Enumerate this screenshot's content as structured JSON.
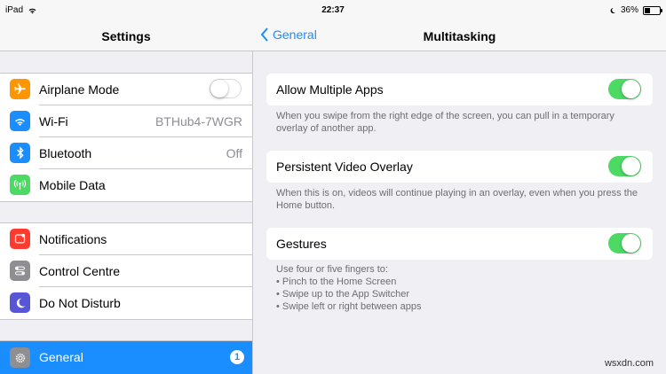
{
  "status": {
    "device": "iPad",
    "time": "22:37",
    "battery": "36%",
    "battery_level": 0.36
  },
  "sidebar": {
    "title": "Settings",
    "group1": [
      {
        "label": "Airplane Mode",
        "icon": "airplane-icon",
        "color": "#ff9500",
        "value": ""
      },
      {
        "label": "Wi-Fi",
        "icon": "wifi-icon",
        "color": "#1a8dff",
        "value": "BTHub4-7WGR"
      },
      {
        "label": "Bluetooth",
        "icon": "bluetooth-icon",
        "color": "#1a8dff",
        "value": "Off"
      },
      {
        "label": "Mobile Data",
        "icon": "antenna-icon",
        "color": "#4cd964",
        "value": ""
      }
    ],
    "group2": [
      {
        "label": "Notifications",
        "icon": "notifications-icon",
        "color": "#ff3b30"
      },
      {
        "label": "Control Centre",
        "icon": "control-centre-icon",
        "color": "#8e8e93"
      },
      {
        "label": "Do Not Disturb",
        "icon": "moon-icon",
        "color": "#5856d6"
      }
    ],
    "general": {
      "label": "General",
      "icon": "gear-icon",
      "badge": "1",
      "color": "#8e8e93"
    }
  },
  "detail": {
    "back_label": "General",
    "title": "Multitasking",
    "settings": [
      {
        "label": "Allow Multiple Apps",
        "on": true,
        "footer": "When you swipe from the right edge of the screen, you can pull in a temporary overlay of another app."
      },
      {
        "label": "Persistent Video Overlay",
        "on": true,
        "footer": "When this is on, videos will continue playing in an overlay, even when you press the Home button."
      },
      {
        "label": "Gestures",
        "on": true,
        "footer": "Use four or five fingers to:"
      }
    ],
    "gesture_list": [
      "• Pinch to the Home Screen",
      "• Swipe up to the App Switcher",
      "• Swipe left or right between apps"
    ]
  },
  "watermark": "wsxdn.com",
  "colors": {
    "accent": "#1a8dff",
    "toggle_on": "#4cd964",
    "background": "#efeff4"
  }
}
